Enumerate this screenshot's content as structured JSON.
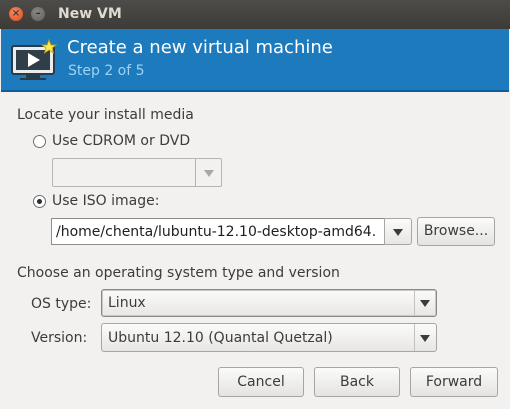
{
  "window": {
    "title": "New VM"
  },
  "banner": {
    "title": "Create a new virtual machine",
    "step": "Step 2 of 5"
  },
  "install_media": {
    "heading": "Locate your install media",
    "cdrom_label": "Use CDROM or DVD",
    "cdrom_selected": false,
    "cdrom_value": "",
    "iso_label": "Use ISO image:",
    "iso_selected": true,
    "iso_path": "/home/chenta/lubuntu-12.10-desktop-amd64.",
    "browse_label": "Browse..."
  },
  "os": {
    "heading": "Choose an operating system type and version",
    "type_label": "OS type:",
    "type_value": "Linux",
    "version_label": "Version:",
    "version_value": "Ubuntu 12.10 (Quantal Quetzal)"
  },
  "buttons": {
    "cancel": "Cancel",
    "back": "Back",
    "forward": "Forward"
  }
}
